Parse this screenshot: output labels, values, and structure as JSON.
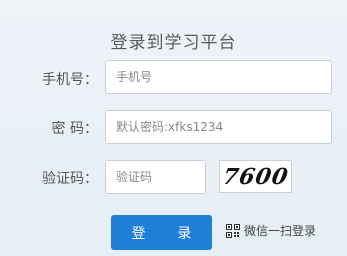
{
  "title": "登录到学习平台",
  "form": {
    "phone_label": "手机号：",
    "phone_placeholder": "手机号",
    "password_label": "密  码：",
    "password_placeholder": "默认密码:xfks1234",
    "captcha_label": "验证码：",
    "captcha_placeholder": "验证码",
    "captcha_image_text": "7600"
  },
  "login_button": "登 录",
  "wechat_login": "微信一扫登录",
  "icons": {
    "qr": "qr-code-icon"
  }
}
